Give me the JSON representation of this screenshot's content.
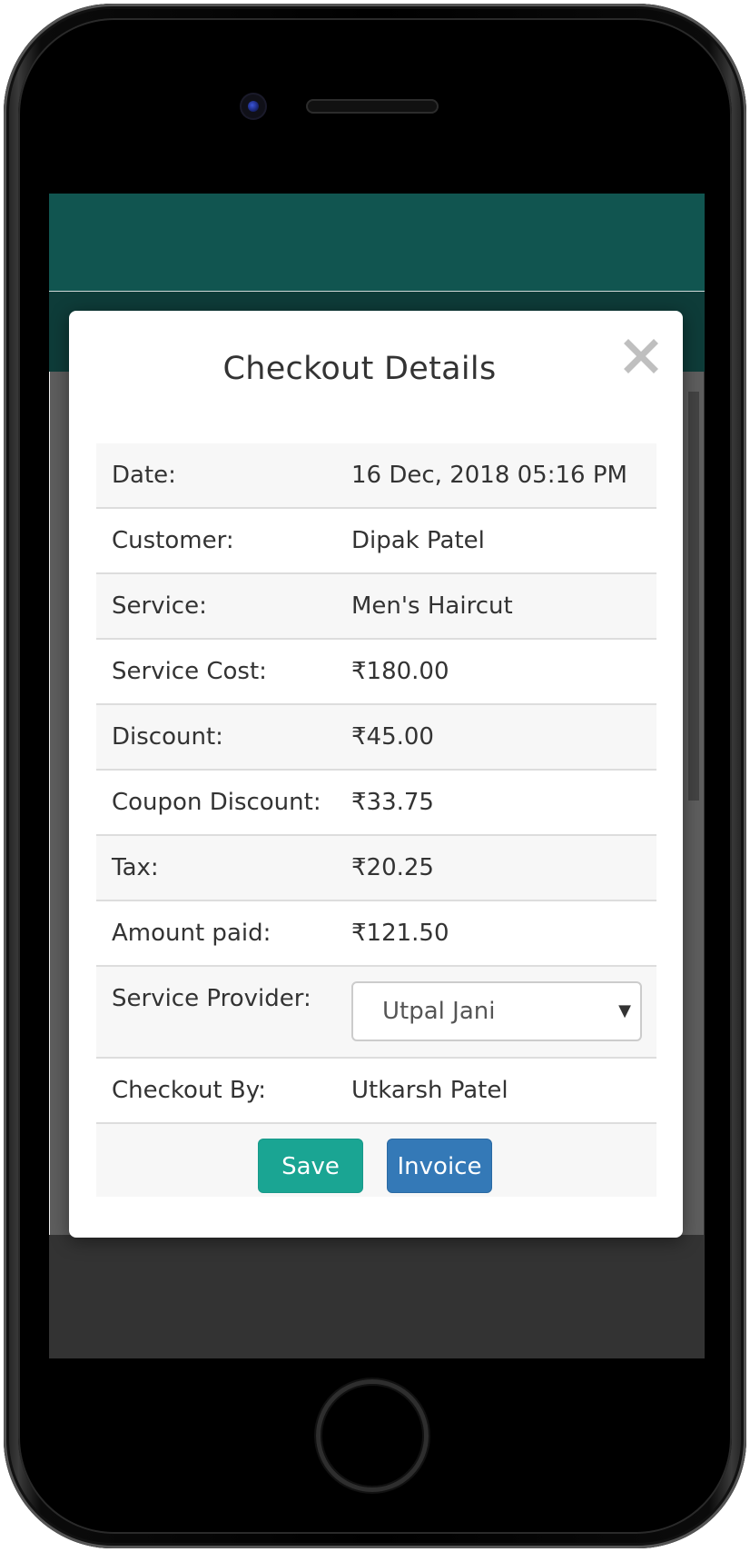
{
  "modal": {
    "title": "Checkout Details",
    "close_icon": "close-icon"
  },
  "details": [
    {
      "label": "Date:",
      "value": "16 Dec, 2018 05:16 PM"
    },
    {
      "label": "Customer:",
      "value": "Dipak Patel"
    },
    {
      "label": "Service:",
      "value": "Men's Haircut"
    },
    {
      "label": "Service Cost:",
      "value": "₹180.00"
    },
    {
      "label": "Discount:",
      "value": "₹45.00"
    },
    {
      "label": "Coupon Discount:",
      "value": "₹33.75"
    },
    {
      "label": "Tax:",
      "value": "₹20.25"
    },
    {
      "label": "Amount paid:",
      "value": "₹121.50"
    }
  ],
  "provider": {
    "label": "Service Provider:",
    "selected": "Utpal Jani",
    "caret_icon": "caret-down-icon"
  },
  "checkout_by": {
    "label": "Checkout By:",
    "value": "Utkarsh Patel"
  },
  "actions": {
    "save_label": "Save",
    "invoice_label": "Invoice"
  },
  "colors": {
    "header": "#115550",
    "save": "#1aa593",
    "invoice": "#3479b7"
  }
}
